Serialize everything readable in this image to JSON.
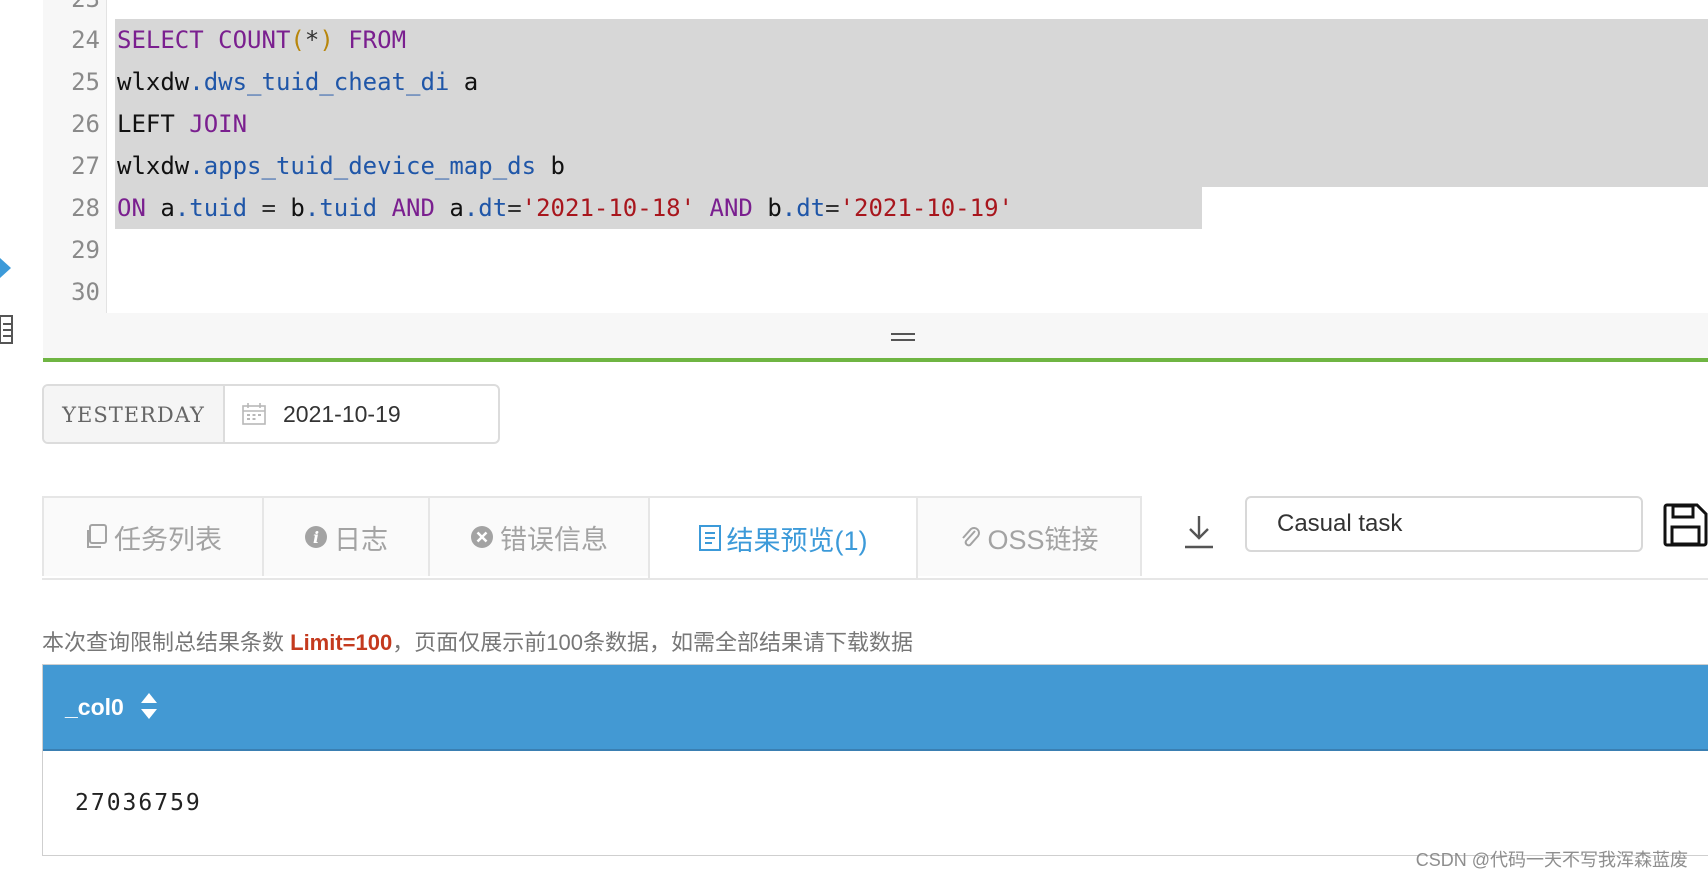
{
  "editor": {
    "lines": [
      {
        "num": "24",
        "selected": "full"
      },
      {
        "num": "25",
        "selected": "full"
      },
      {
        "num": "26",
        "selected": "full"
      },
      {
        "num": "27",
        "selected": "full"
      },
      {
        "num": "28",
        "selected": "partial"
      },
      {
        "num": "29",
        "selected": "none"
      },
      {
        "num": "30",
        "selected": "none"
      }
    ],
    "tokens": {
      "select": "SELECT",
      "count": "COUNT",
      "paren_open": "(",
      "star": "*",
      "paren_close": ")",
      "from": "FROM",
      "schema1": "wlxdw",
      "table1": "dws_tuid_cheat_di",
      "alias_a": "a",
      "left": "LEFT",
      "join": "JOIN",
      "schema2": "wlxdw",
      "table2": "apps_tuid_device_map_ds",
      "alias_b": "b",
      "on": "ON",
      "a": "a",
      "tuid": "tuid",
      "eq": "=",
      "b": "b",
      "and": "AND",
      "dt": "dt",
      "date1": "'2021-10-18'",
      "date2": "'2021-10-19'"
    }
  },
  "date_picker": {
    "label": "YESTERDAY",
    "value": "2021-10-19",
    "icon": "calendar-icon"
  },
  "tabs": [
    {
      "label": "任务列表",
      "icon": "copy-icon",
      "active": false
    },
    {
      "label": "日志",
      "icon": "info-icon",
      "active": false
    },
    {
      "label": "错误信息",
      "icon": "error-icon",
      "active": false
    },
    {
      "label": "结果预览(1)",
      "icon": "document-icon",
      "active": true
    },
    {
      "label": "OSS链接",
      "icon": "paperclip-icon",
      "active": false
    }
  ],
  "task_input": {
    "value": "Casual task"
  },
  "notice": {
    "prefix": "本次查询限制总结果条数 ",
    "limit": "Limit=100",
    "suffix": "，页面仅展示前100条数据，如需全部结果请下载数据"
  },
  "result": {
    "columns": [
      "_col0"
    ],
    "rows": [
      [
        "27036759"
      ]
    ]
  },
  "credit": "CSDN @代码一天不写我浑森蓝废",
  "colors": {
    "accent": "#3c9ad9",
    "header_bg": "#4399d3",
    "divider_green": "#6fb543",
    "keyword": "#7a1f8f",
    "property": "#1f56a8",
    "string": "#a8161d"
  }
}
